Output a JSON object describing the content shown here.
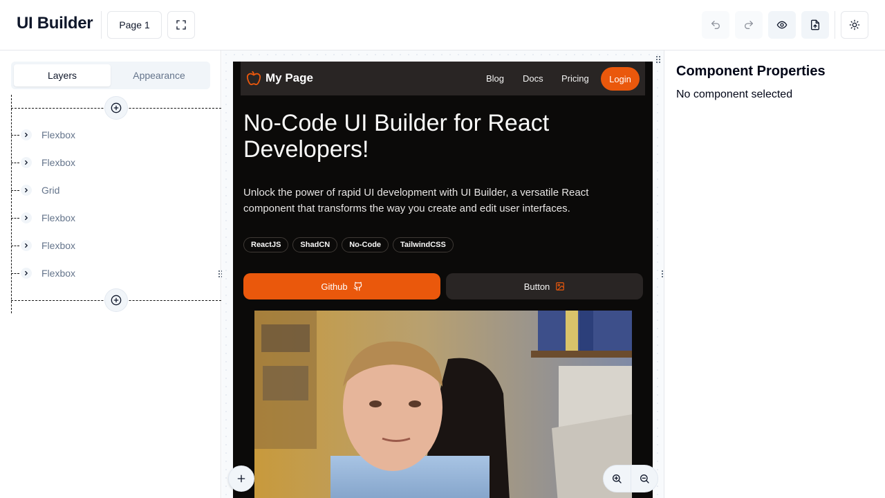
{
  "app": {
    "title": "UI Builder"
  },
  "toolbar": {
    "page_selector": "Page 1",
    "icons": [
      "fullscreen-icon",
      "undo-icon",
      "redo-icon",
      "eye-icon",
      "file-export-icon",
      "sun-icon"
    ]
  },
  "left_panel": {
    "tabs": [
      {
        "label": "Layers",
        "active": true
      },
      {
        "label": "Appearance",
        "active": false
      }
    ],
    "layers": [
      {
        "label": "Flexbox"
      },
      {
        "label": "Flexbox"
      },
      {
        "label": "Grid"
      },
      {
        "label": "Flexbox"
      },
      {
        "label": "Flexbox"
      },
      {
        "label": "Flexbox"
      }
    ]
  },
  "preview": {
    "nav": {
      "brand": "My Page",
      "links": [
        "Blog",
        "Docs",
        "Pricing"
      ],
      "login": "Login"
    },
    "hero": {
      "title": "No-Code UI Builder for React Developers!",
      "subtitle": "Unlock the power of rapid UI development with UI Builder, a versatile React component that transforms the way you create and edit user interfaces.",
      "chips": [
        "ReactJS",
        "ShadCN",
        "No-Code",
        "TailwindCSS"
      ],
      "primary_button": "Github",
      "secondary_button": "Button"
    },
    "colors": {
      "accent": "#ea580c",
      "background": "#0b0a09",
      "nav": "#292524"
    }
  },
  "right_panel": {
    "title": "Component Properties",
    "empty_state": "No component selected"
  }
}
